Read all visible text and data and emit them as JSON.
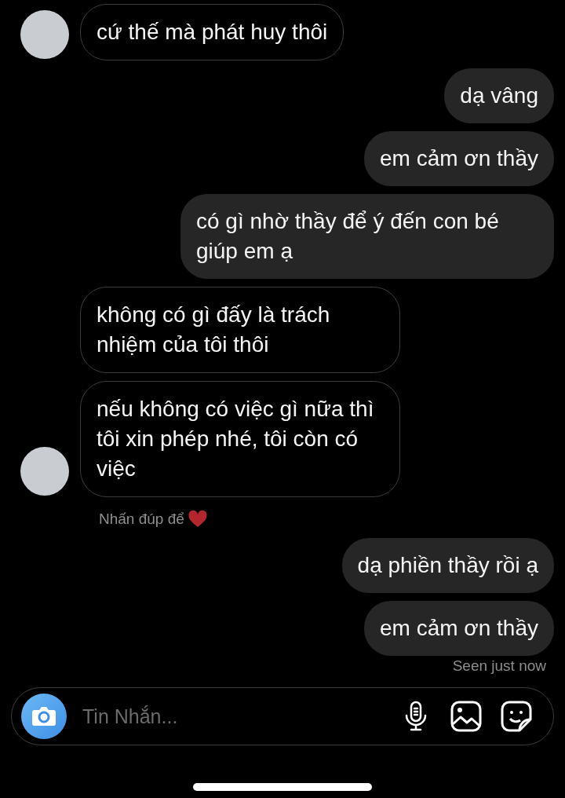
{
  "messages": [
    {
      "kind": "received",
      "avatar": true,
      "text": "cứ thế mà phát huy thôi"
    },
    {
      "kind": "sent",
      "avatar": false,
      "text": "dạ vâng"
    },
    {
      "kind": "sent",
      "avatar": false,
      "text": "em cảm ơn thầy"
    },
    {
      "kind": "sent",
      "avatar": false,
      "text": "có gì nhờ thầy để ý đến con bé giúp em ạ"
    },
    {
      "kind": "received",
      "avatar": false,
      "text": "không có gì đấy là trách nhiệm của tôi thôi"
    },
    {
      "kind": "received",
      "avatar": true,
      "text": "nếu không có việc gì nữa thì tôi xin phép nhé, tôi còn có việc",
      "hint": "Nhấn đúp để"
    },
    {
      "kind": "sent",
      "avatar": false,
      "text": "dạ phiền thầy rồi ạ"
    },
    {
      "kind": "sent",
      "avatar": false,
      "text": "em cảm ơn thầy"
    }
  ],
  "seen": "Seen just now",
  "composer": {
    "placeholder": "Tin Nhắn..."
  }
}
